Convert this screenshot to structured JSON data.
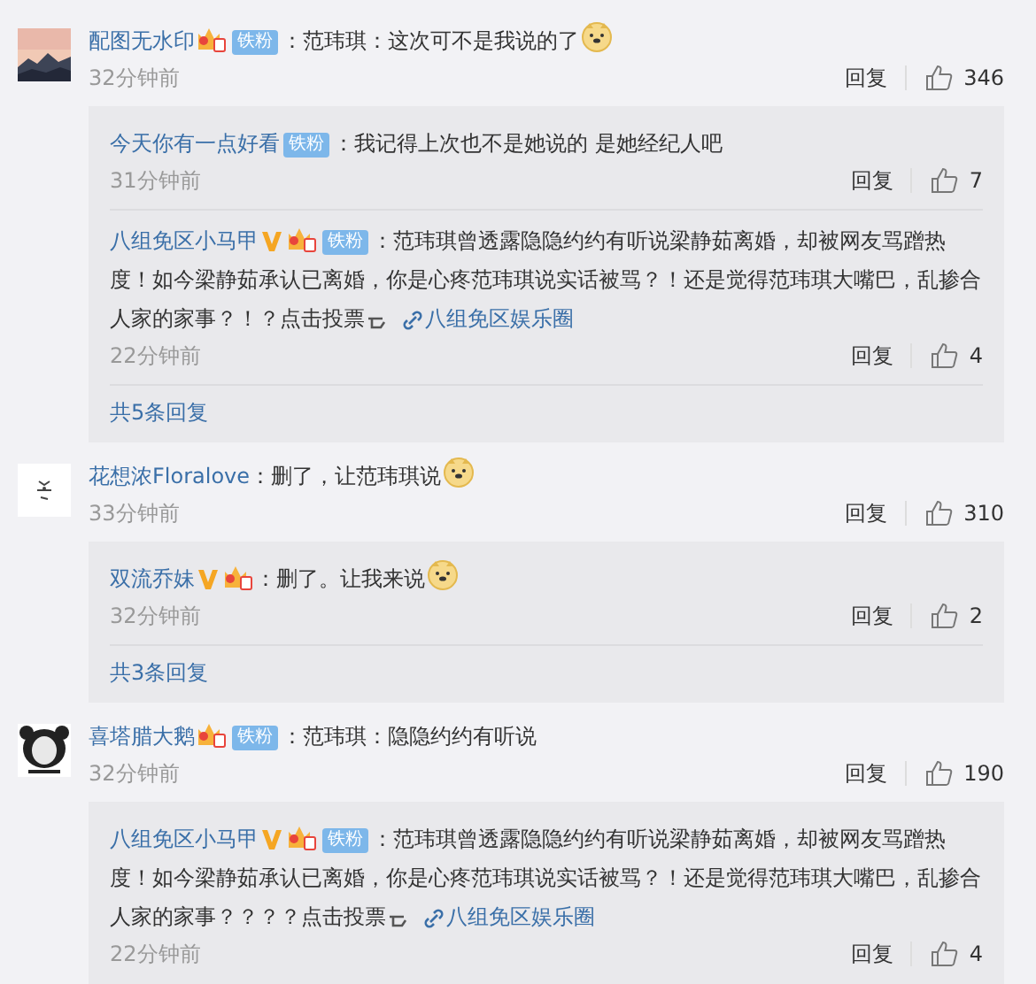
{
  "comments": [
    {
      "user": "配图无水印",
      "badges": [
        {
          "kind": "crown"
        },
        {
          "kind": "fan",
          "label": "铁粉"
        }
      ],
      "text": "：范玮琪：这次可不是我说的了",
      "emoji": true,
      "time": "32分钟前",
      "reply_label": "回复",
      "likes": "346",
      "replies": [
        {
          "user": "今天你有一点好看",
          "badges": [
            {
              "kind": "fan",
              "label": "铁粉"
            }
          ],
          "text": "：我记得上次也不是她说的 是她经纪人吧",
          "emoji": false,
          "time": "31分钟前",
          "reply_label": "回复",
          "likes": "7"
        },
        {
          "user": "八组免区小马甲",
          "badges": [
            {
              "kind": "verified"
            },
            {
              "kind": "crown"
            },
            {
              "kind": "fan",
              "label": "铁粉"
            }
          ],
          "text": "：范玮琪曾透露隐隐约约有听说梁静茹离婚，却被网友骂蹭热度！如今梁静茹承认已离婚，你是心疼范玮琪说实话被骂？！还是觉得范玮琪大嘴巴，乱掺合人家的家事？！？点击投票",
          "pointer": true,
          "link": "八组免区娱乐圈",
          "emoji": false,
          "time": "22分钟前",
          "reply_label": "回复",
          "likes": "4"
        }
      ],
      "more": "共5条回复"
    },
    {
      "user": "花想浓Floralove",
      "text": "：删了，让范玮琪说",
      "emoji": true,
      "time": "33分钟前",
      "reply_label": "回复",
      "likes": "310",
      "replies": [
        {
          "user": "双流乔妹",
          "badges": [
            {
              "kind": "verified"
            },
            {
              "kind": "crown"
            }
          ],
          "text": "：删了。让我来说",
          "emoji": true,
          "time": "32分钟前",
          "reply_label": "回复",
          "likes": "2"
        }
      ],
      "more": "共3条回复"
    },
    {
      "user": "喜塔腊大鹅",
      "badges": [
        {
          "kind": "crown"
        },
        {
          "kind": "fan",
          "label": "铁粉"
        }
      ],
      "text": "：范玮琪：隐隐约约有听说",
      "emoji": false,
      "time": "32分钟前",
      "reply_label": "回复",
      "likes": "190",
      "replies": [
        {
          "user": "八组免区小马甲",
          "badges": [
            {
              "kind": "verified"
            },
            {
              "kind": "crown"
            },
            {
              "kind": "fan",
              "label": "铁粉"
            }
          ],
          "text": "：范玮琪曾透露隐隐约约有听说梁静茹离婚，却被网友骂蹭热度！如今梁静茹承认已离婚，你是心疼范玮琪说实话被骂？！还是觉得范玮琪大嘴巴，乱掺合人家的家事？？？？点击投票",
          "pointer": true,
          "link": "八组免区娱乐圈",
          "emoji": false,
          "time": "22分钟前",
          "reply_label": "回复",
          "likes": "4"
        }
      ]
    }
  ]
}
